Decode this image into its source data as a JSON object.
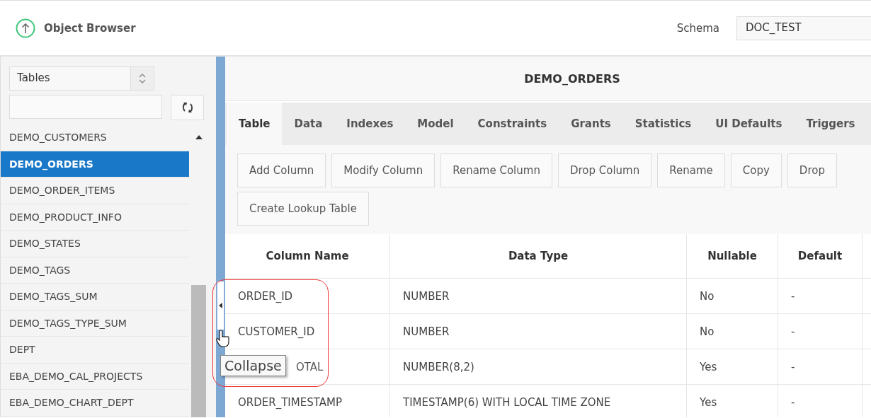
{
  "header": {
    "title": "Object Browser",
    "schema_label": "Schema",
    "schema_value": "DOC_TEST"
  },
  "sidebar": {
    "object_type": "Tables",
    "items": [
      {
        "label": "DEMO_CUSTOMERS",
        "selected": false
      },
      {
        "label": "DEMO_ORDERS",
        "selected": true
      },
      {
        "label": "DEMO_ORDER_ITEMS",
        "selected": false
      },
      {
        "label": "DEMO_PRODUCT_INFO",
        "selected": false
      },
      {
        "label": "DEMO_STATES",
        "selected": false
      },
      {
        "label": "DEMO_TAGS",
        "selected": false
      },
      {
        "label": "DEMO_TAGS_SUM",
        "selected": false
      },
      {
        "label": "DEMO_TAGS_TYPE_SUM",
        "selected": false
      },
      {
        "label": "DEPT",
        "selected": false
      },
      {
        "label": "EBA_DEMO_CAL_PROJECTS",
        "selected": false
      },
      {
        "label": "EBA_DEMO_CHART_DEPT",
        "selected": false
      }
    ]
  },
  "object_title": "DEMO_ORDERS",
  "tabs": [
    {
      "label": "Table",
      "selected": true
    },
    {
      "label": "Data",
      "selected": false
    },
    {
      "label": "Indexes",
      "selected": false
    },
    {
      "label": "Model",
      "selected": false
    },
    {
      "label": "Constraints",
      "selected": false
    },
    {
      "label": "Grants",
      "selected": false
    },
    {
      "label": "Statistics",
      "selected": false
    },
    {
      "label": "UI Defaults",
      "selected": false
    },
    {
      "label": "Triggers",
      "selected": false
    }
  ],
  "buttons": [
    "Add Column",
    "Modify Column",
    "Rename Column",
    "Drop Column",
    "Rename",
    "Copy",
    "Drop",
    "Create Lookup Table"
  ],
  "table": {
    "columns": [
      "Column Name",
      "Data Type",
      "Nullable",
      "Default"
    ],
    "rows": [
      {
        "cells": [
          "ORDER_ID",
          "NUMBER",
          "No",
          "-"
        ],
        "covered": false
      },
      {
        "cells": [
          "CUSTOMER_ID",
          "NUMBER",
          "No",
          "-"
        ],
        "covered": false
      },
      {
        "cells": [
          "OTAL",
          "NUMBER(8,2)",
          "Yes",
          "-"
        ],
        "covered": true
      },
      {
        "cells": [
          "ORDER_TIMESTAMP",
          "TIMESTAMP(6) WITH LOCAL TIME ZONE",
          "Yes",
          "-"
        ],
        "covered": false
      }
    ]
  },
  "tooltip": "Collapse"
}
